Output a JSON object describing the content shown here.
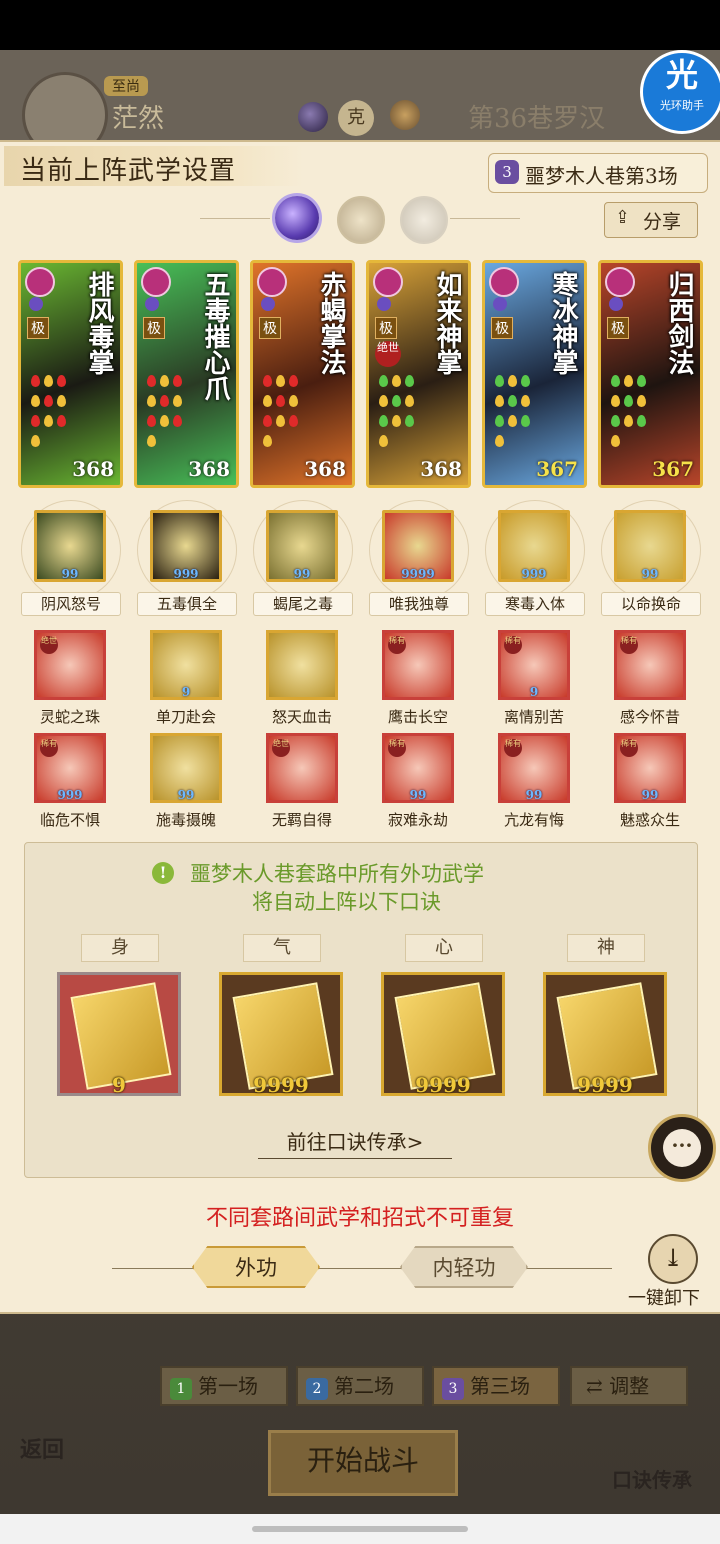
{
  "header": {
    "player_rank": "至尚",
    "player_name": "茫然",
    "vs_label": "克",
    "opponent_name": "第36巷罗汉",
    "helper_badge_main": "光",
    "helper_badge_sub": "光环助手"
  },
  "panel": {
    "title": "当前上阵武学设置",
    "match_number": "3",
    "match_label": "噩梦木人巷第3场",
    "share_label": "分享",
    "share_icon": "share-icon"
  },
  "cards": [
    {
      "name": "排风毒掌",
      "grade": "极",
      "level": "368",
      "special": "",
      "level_color": "#ffffff",
      "colors": [
        "#1a1a14",
        "#6ab832"
      ]
    },
    {
      "name": "五毒摧心爪",
      "grade": "极",
      "level": "368",
      "special": "",
      "level_color": "#ffffff",
      "colors": [
        "#2a3a24",
        "#48c058"
      ]
    },
    {
      "name": "赤蝎掌法",
      "grade": "极",
      "level": "368",
      "special": "",
      "level_color": "#ffffff",
      "colors": [
        "#4a1e10",
        "#e0742a"
      ]
    },
    {
      "name": "如来神掌",
      "grade": "极",
      "level": "368",
      "special": "绝世",
      "level_color": "#ffffff",
      "colors": [
        "#2a1e14",
        "#d8a238"
      ]
    },
    {
      "name": "寒冰神掌",
      "grade": "极",
      "level": "367",
      "special": "",
      "level_color": "#f6e24a",
      "colors": [
        "#1a2438",
        "#6aa8e0"
      ]
    },
    {
      "name": "归西剑法",
      "grade": "极",
      "level": "367",
      "special": "",
      "level_color": "#f6e24a",
      "colors": [
        "#1e1410",
        "#b8452a"
      ]
    }
  ],
  "moves_row1": [
    {
      "label": "阴风怒号",
      "count": "99"
    },
    {
      "label": "五毒俱全",
      "count": "999"
    },
    {
      "label": "蝎尾之毒",
      "count": "99"
    },
    {
      "label": "唯我独尊",
      "count": "9999"
    },
    {
      "label": "寒毒入体",
      "count": "999"
    },
    {
      "label": "以命换命",
      "count": "99"
    }
  ],
  "moves_row2": [
    {
      "label": "灵蛇之珠",
      "tag": "绝世",
      "count": ""
    },
    {
      "label": "单刀赴会",
      "tag": "",
      "count": "9"
    },
    {
      "label": "怒天血击",
      "tag": "",
      "count": ""
    },
    {
      "label": "鹰击长空",
      "tag": "稀有",
      "count": ""
    },
    {
      "label": "离情别苦",
      "tag": "稀有",
      "count": "9"
    },
    {
      "label": "感今怀昔",
      "tag": "稀有",
      "count": ""
    }
  ],
  "moves_row3": [
    {
      "label": "临危不惧",
      "tag": "稀有",
      "count": "999"
    },
    {
      "label": "施毒摄魄",
      "tag": "",
      "count": "99"
    },
    {
      "label": "无羁自得",
      "tag": "绝世",
      "count": ""
    },
    {
      "label": "寂难永劫",
      "tag": "稀有",
      "count": "99"
    },
    {
      "label": "亢龙有悔",
      "tag": "稀有",
      "count": "99"
    },
    {
      "label": "魅惑众生",
      "tag": "稀有",
      "count": "99"
    }
  ],
  "info": {
    "line1": "噩梦木人巷套路中所有外功武学",
    "line2": "将自动上阵以下口诀",
    "slots": [
      {
        "tag": "身",
        "count": "9"
      },
      {
        "tag": "气",
        "count": "9999"
      },
      {
        "tag": "心",
        "count": "9999"
      },
      {
        "tag": "神",
        "count": "9999"
      }
    ],
    "goto_label": "前往口诀传承>"
  },
  "warning": "不同套路间武学和招式不可重复",
  "tabs": {
    "waigong": "外功",
    "neiqing": "内轻功"
  },
  "unload_label": "一键卸下",
  "stages": [
    {
      "num": "1",
      "label": "第一场",
      "color": "#4a8a3a"
    },
    {
      "num": "2",
      "label": "第二场",
      "color": "#3a6aa0"
    },
    {
      "num": "3",
      "label": "第三场",
      "color": "#6a4ea0"
    }
  ],
  "adjust_label": "调整",
  "start_label": "开始战斗",
  "back_label": "返回",
  "kj_inherit_label": "口诀传承"
}
